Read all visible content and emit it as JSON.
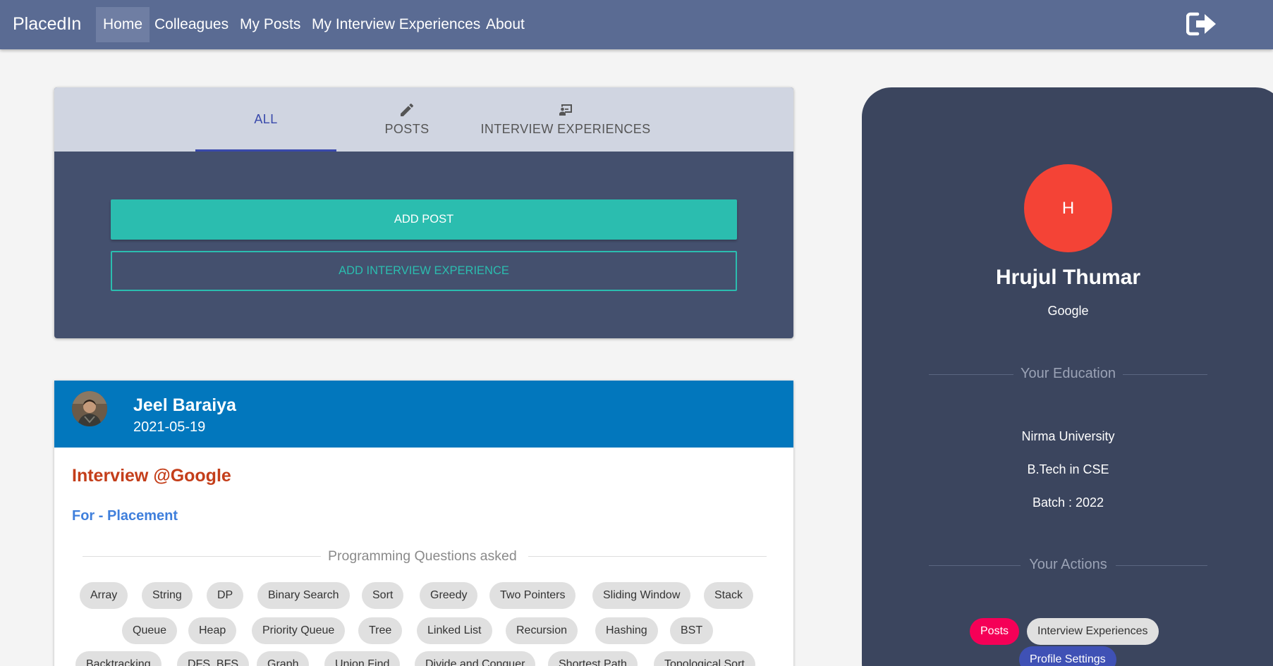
{
  "navbar": {
    "brand": "PlacedIn",
    "links": [
      {
        "label": "Home",
        "active": true
      },
      {
        "label": "Colleagues"
      },
      {
        "label": "My Posts"
      },
      {
        "label": "My Interview Experiences"
      },
      {
        "label": "About"
      }
    ],
    "logout_icon": "logout-icon"
  },
  "tabs": [
    {
      "label": "ALL",
      "icon": "none"
    },
    {
      "label": "POSTS",
      "icon": "pencil-icon"
    },
    {
      "label": "INTERVIEW EXPERIENCES",
      "icon": "presentation-icon"
    }
  ],
  "actions": {
    "add_post": "ADD POST",
    "add_interview_experience": "ADD INTERVIEW EXPERIENCE"
  },
  "post": {
    "author": "Jeel Baraiya",
    "date": "2021-05-19",
    "title": "Interview @Google",
    "subtitle": "For - Placement",
    "section_label": "Programming Questions asked",
    "tags": [
      "Array",
      "String",
      "DP",
      "Binary Search",
      "Sort",
      "Greedy",
      "Two Pointers",
      "Sliding Window",
      "Stack",
      "Queue",
      "Heap",
      "Priority Queue",
      "Tree",
      "Linked List",
      "Recursion",
      "Hashing",
      "BST",
      "Backtracking",
      "DFS_BFS",
      "Graph",
      "Union Find",
      "Divide and Conquer",
      "Shortest Path",
      "Topological Sort"
    ]
  },
  "profile": {
    "initial": "H",
    "name": "Hrujul Thumar",
    "company": "Google",
    "education_heading": "Your Education",
    "university": "Nirma University",
    "degree": "B.Tech in CSE",
    "batch": "Batch : 2022",
    "actions_heading": "Your Actions",
    "action_chips": [
      "Posts",
      "Interview Experiences",
      "Profile Settings"
    ]
  },
  "colors": {
    "navbar": "#5a6b93",
    "tab_active": "#3949ab",
    "teal": "#2bbdaf",
    "post_header": "#0277bd",
    "title_red": "#c43e1a",
    "subtitle_blue": "#3f7fdc",
    "profile_bg": "#3b455e",
    "avatar_red": "#f44336",
    "chip_pink": "#f50057",
    "chip_indigo": "#3f51b5"
  }
}
